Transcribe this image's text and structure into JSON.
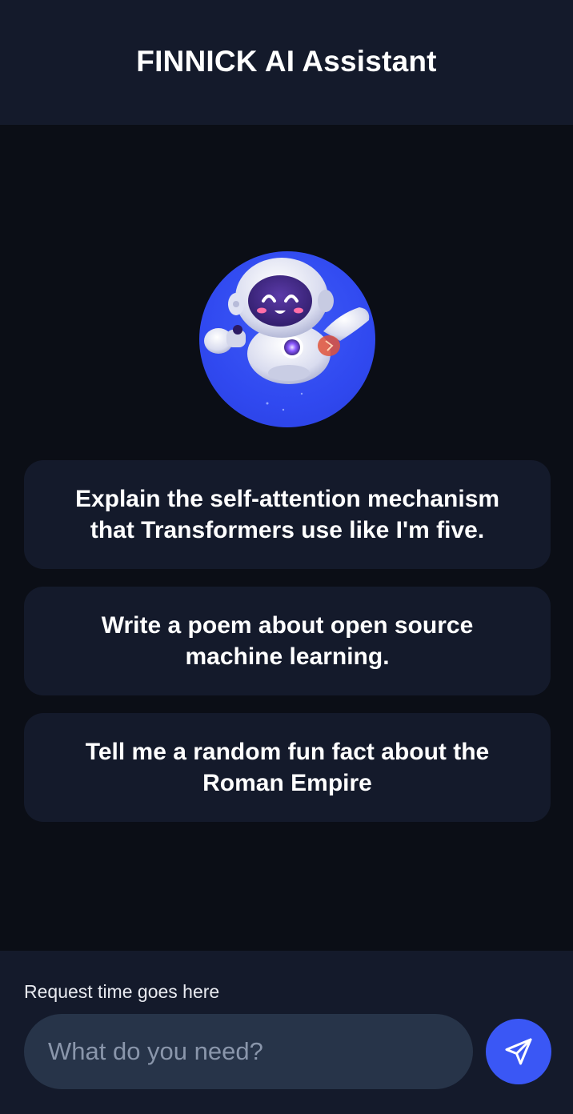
{
  "header": {
    "title": "FINNICK AI Assistant"
  },
  "avatar": {
    "icon": "robot-mascot-icon",
    "background_color": "#3a57f5"
  },
  "prompts": [
    {
      "text": "Explain the self-attention mechanism that Transformers use like I'm five."
    },
    {
      "text": "Write a poem about open source machine learning."
    },
    {
      "text": "Tell me a random fun fact about the Roman Empire"
    }
  ],
  "footer": {
    "request_time": "Request time goes here",
    "input_placeholder": "What do you need?",
    "send_icon": "send-icon",
    "accent_color": "#3a57f5"
  }
}
